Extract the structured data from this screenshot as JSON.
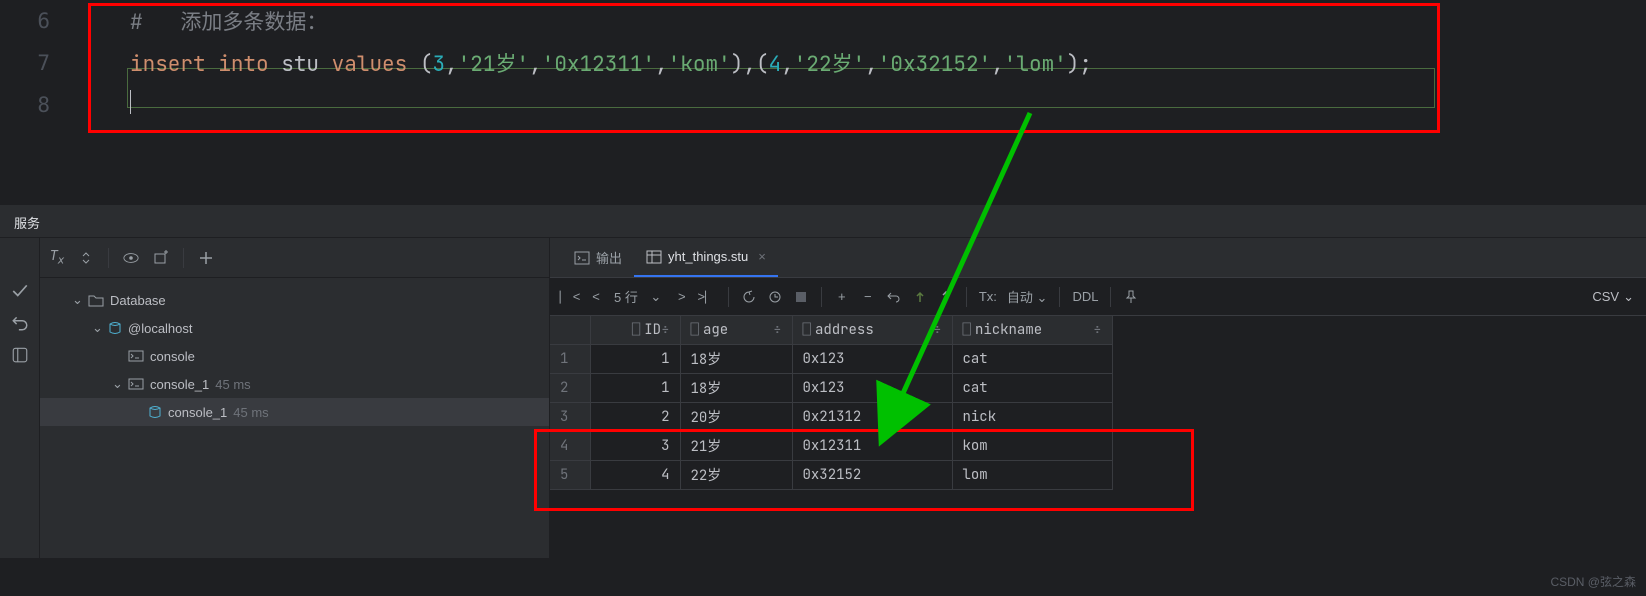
{
  "editor": {
    "lines": [
      "6",
      "7",
      "8"
    ],
    "comment_prefix": "#",
    "comment_text": "添加多条数据：",
    "sql": {
      "kw_insert": "insert",
      "kw_into": "into",
      "table": "stu",
      "kw_values": "values",
      "values_text": "(3,'21岁','0x12311','kom'),(4,'22岁','0x32152','lom');"
    }
  },
  "panel_title": "服务",
  "tree": {
    "root": "Database",
    "host": "@localhost",
    "console": "console",
    "console1": "console_1",
    "console1_time": "45 ms",
    "console1_child": "console_1",
    "console1_child_time": "45 ms"
  },
  "tabs": {
    "output": "输出",
    "table_tab": "yht_things.stu"
  },
  "db_toolbar": {
    "rows_label": "5 行",
    "tx_label": "Tx:",
    "tx_value": "自动",
    "ddl": "DDL",
    "csv": "CSV"
  },
  "table": {
    "columns": [
      "ID",
      "age",
      "address",
      "nickname"
    ],
    "rows": [
      {
        "n": "1",
        "id": "1",
        "age": "18岁",
        "address": "0x123",
        "nickname": "cat"
      },
      {
        "n": "2",
        "id": "1",
        "age": "18岁",
        "address": "0x123",
        "nickname": "cat"
      },
      {
        "n": "3",
        "id": "2",
        "age": "20岁",
        "address": "0x21312",
        "nickname": "nick"
      },
      {
        "n": "4",
        "id": "3",
        "age": "21岁",
        "address": "0x12311",
        "nickname": "kom"
      },
      {
        "n": "5",
        "id": "4",
        "age": "22岁",
        "address": "0x32152",
        "nickname": "lom"
      }
    ]
  },
  "watermark": "CSDN @弦之森"
}
